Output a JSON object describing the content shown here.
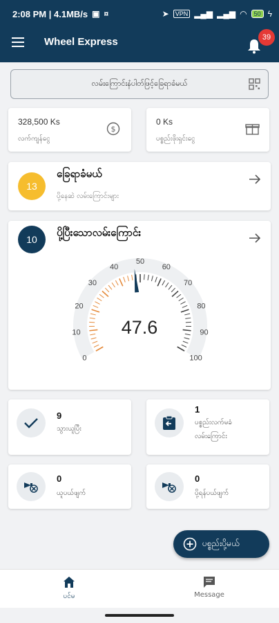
{
  "status_bar": {
    "time_speed": "2:08 PM | 4.1MB/s",
    "vpn": "VPN",
    "battery": "50"
  },
  "app_bar": {
    "title": "Wheel Express",
    "notification_count": "39"
  },
  "search": {
    "placeholder": "လမ်းကြောင်းနံပါတ်ဖြင့်ခြေရာခံမယ်"
  },
  "stats": {
    "balance_value": "328,500 Ks",
    "balance_label": "လက်ကျန်ငွေ",
    "deposit_value": "0 Ks",
    "deposit_label": "ပစ္စည်းဖိုးရှင်းငွေ"
  },
  "tracking_card": {
    "count": "13",
    "title": "ခြေရာခံမယ်",
    "subtitle": "ပို့နေဆဲ လမ်းကြောင်းများ"
  },
  "completed_card": {
    "count": "10",
    "title": "ပို့ပြီးသောလမ်းကြောင်း"
  },
  "gauge": {
    "value": 47.6,
    "display_value": "47.6",
    "min": 0,
    "max": 100,
    "tick_labels": [
      "0",
      "10",
      "20",
      "30",
      "40",
      "50",
      "60",
      "70",
      "80",
      "90",
      "100"
    ]
  },
  "mini_cards": {
    "delivered_count": "9",
    "delivered_label": "သွားယူပြီး",
    "return_count": "1",
    "return_label_1": "ပစ္စည်းလက်မခံ",
    "return_label_2": "လမ်းကြောင်း",
    "pickup_cancel_count": "0",
    "pickup_cancel_label": "ယူပယ်ဖျက်",
    "delivery_cancel_count": "0",
    "delivery_cancel_label": "ပို့ရန်ပယ်ဖျက်"
  },
  "fab": {
    "label": "ပစ္စည်းပို့မယ်"
  },
  "bottom_nav": {
    "home_label": "ပင်မ",
    "message_label": "Message"
  },
  "colors": {
    "primary": "#123b5a",
    "accent_yellow": "#f6bd2e",
    "badge_red": "#e53935",
    "gauge_orange": "#e58a3a"
  }
}
